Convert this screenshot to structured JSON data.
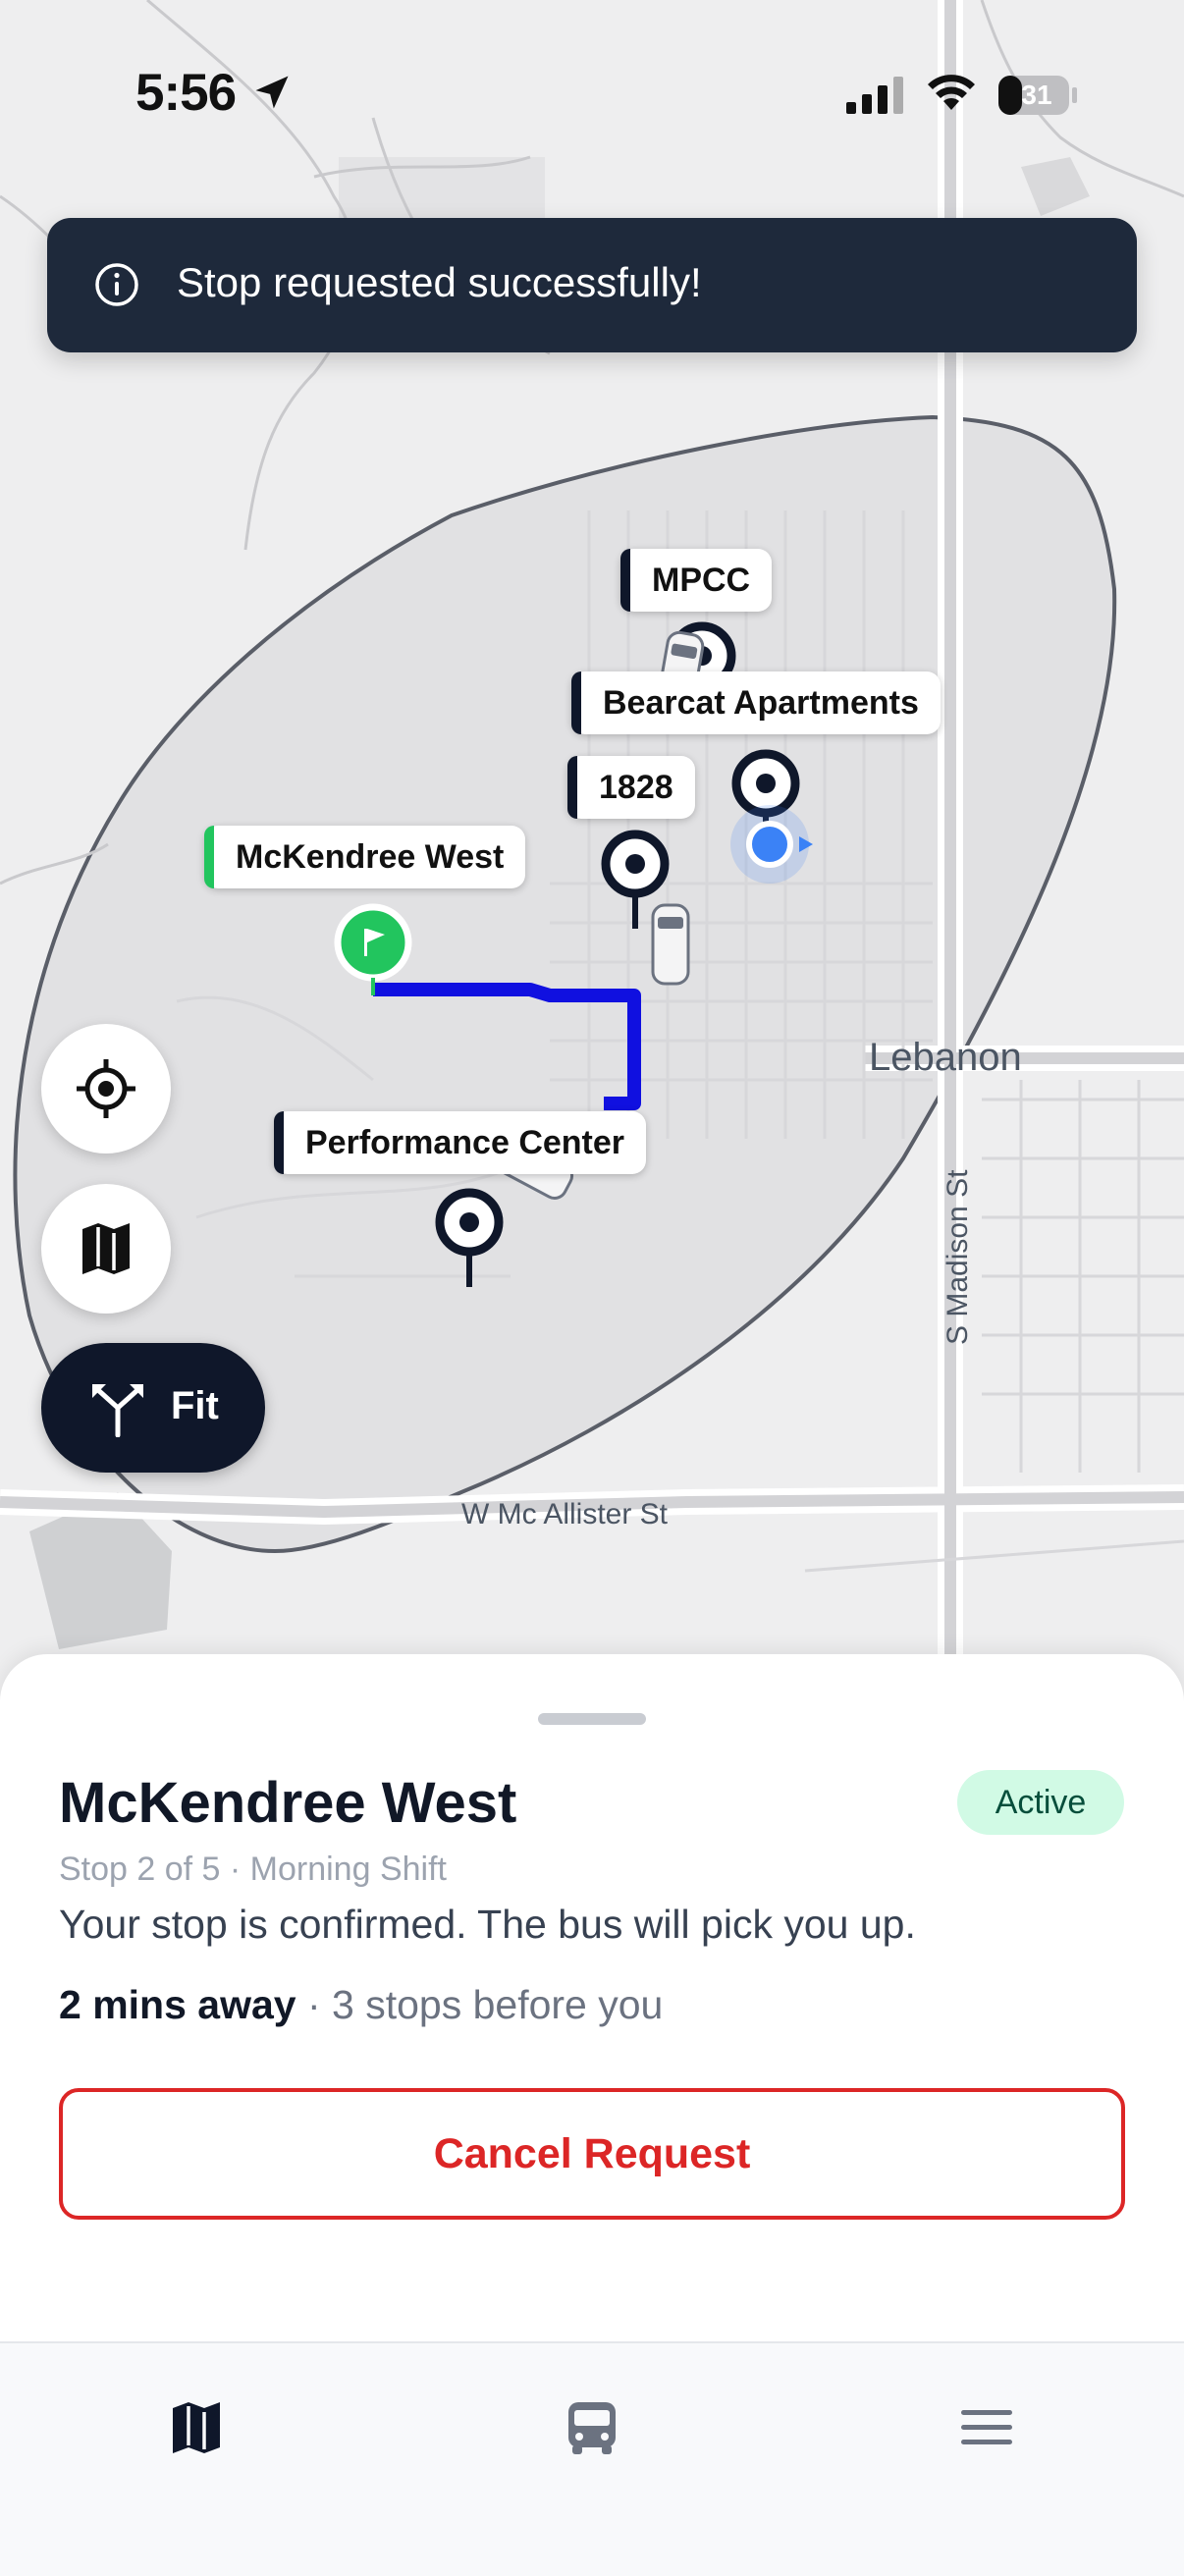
{
  "status_bar": {
    "time": "5:56",
    "battery": "31"
  },
  "toast": {
    "message": "Stop requested successfully!",
    "icon": "info-icon"
  },
  "map": {
    "stops": [
      {
        "label": "MPCC"
      },
      {
        "label": "Bearcat Apartments"
      },
      {
        "label": "1828"
      },
      {
        "label": "McKendree West"
      },
      {
        "label": "Performance Center"
      }
    ],
    "street_labels": {
      "city": "Lebanon",
      "street_1": "S Madison St",
      "street_2": "W Mc Allister St"
    },
    "controls": {
      "fit_label": "Fit"
    }
  },
  "sheet": {
    "title": "McKendree West",
    "badge": "Active",
    "meta": "Stop 2 of 5 · Morning Shift",
    "message": "Your stop is confirmed. The bus will pick you up.",
    "eta_strong": "2 mins away",
    "eta_rest": " · 3 stops before you",
    "cancel_label": "Cancel Request"
  },
  "tabbar": {
    "tabs": [
      "map-icon",
      "bus-icon",
      "menu-icon"
    ],
    "active": "map-icon"
  },
  "colors": {
    "accent": "#0f172a",
    "route": "#1010e0",
    "danger": "#dc2626",
    "active_bg": "#d1fae5",
    "green": "#22c55e"
  }
}
